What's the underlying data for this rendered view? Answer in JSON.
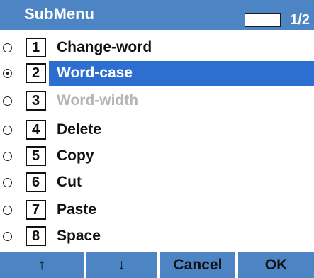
{
  "header": {
    "title": "SubMenu",
    "page": "1/2"
  },
  "menu": {
    "items": [
      {
        "number": "1",
        "label": "Change-word",
        "state": "normal"
      },
      {
        "number": "2",
        "label": "Word-case",
        "state": "selected"
      },
      {
        "number": "3",
        "label": "Word-width",
        "state": "disabled"
      },
      {
        "number": "4",
        "label": "Delete",
        "state": "normal"
      },
      {
        "number": "5",
        "label": "Copy",
        "state": "normal"
      },
      {
        "number": "6",
        "label": "Cut",
        "state": "normal"
      },
      {
        "number": "7",
        "label": "Paste",
        "state": "normal"
      },
      {
        "number": "8",
        "label": "Space",
        "state": "normal"
      }
    ]
  },
  "softkeys": {
    "up": "↑",
    "down": "↓",
    "cancel": "Cancel",
    "ok": "OK"
  },
  "colors": {
    "header_bg": "#4d84c3",
    "selected_bg": "#2d6fd1",
    "disabled_text": "#b5b5b5"
  }
}
